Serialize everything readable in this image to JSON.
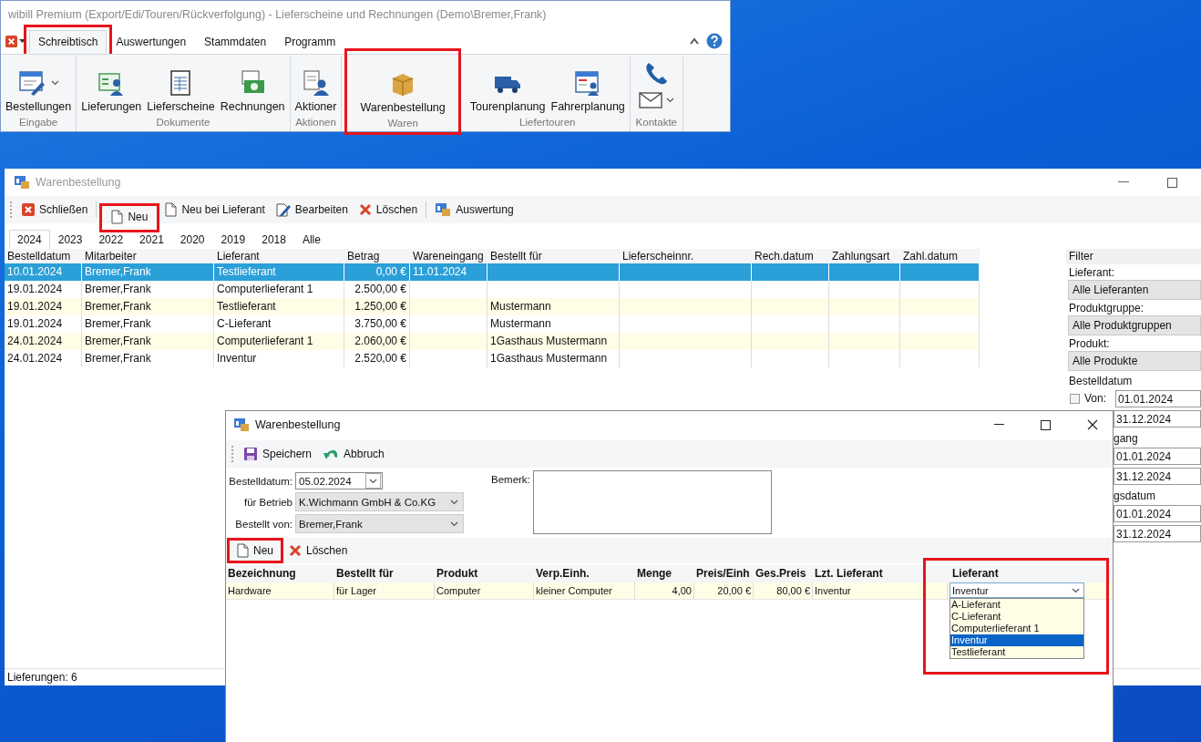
{
  "app_window": {
    "title": "wibill Premium (Export/Edi/Touren/Rückverfolgung) - Lieferscheine und Rechnungen (Demo\\Bremer,Frank)",
    "menu_tabs": [
      {
        "label": "Schreibtisch",
        "selected": true,
        "highlighted": true
      },
      {
        "label": "Auswertungen",
        "selected": false,
        "highlighted": false
      },
      {
        "label": "Stammdaten",
        "selected": false,
        "highlighted": false
      },
      {
        "label": "Programm",
        "selected": false,
        "highlighted": false
      }
    ],
    "ribbon_groups": [
      {
        "label": "Eingabe",
        "highlighted": false,
        "buttons": [
          {
            "label": "Bestellungen",
            "dropdown": true
          }
        ]
      },
      {
        "label": "Dokumente",
        "highlighted": false,
        "buttons": [
          {
            "label": "Lieferungen",
            "dropdown": false
          },
          {
            "label": "Lieferscheine",
            "dropdown": false
          },
          {
            "label": "Rechnungen",
            "dropdown": false
          }
        ]
      },
      {
        "label": "Aktionen",
        "highlighted": false,
        "buttons": [
          {
            "label": "Aktioner",
            "dropdown": false
          }
        ]
      },
      {
        "label": "Waren",
        "highlighted": true,
        "buttons": [
          {
            "label": "Warenbestellung",
            "dropdown": false
          }
        ]
      },
      {
        "label": "Liefertouren",
        "highlighted": false,
        "buttons": [
          {
            "label": "Tourenplanung",
            "dropdown": false
          },
          {
            "label": "Fahrerplanung",
            "dropdown": false
          }
        ]
      },
      {
        "label": "Kontakte",
        "highlighted": false,
        "buttons": [
          {
            "dropdown": false
          },
          {
            "dropdown": true
          }
        ]
      }
    ]
  },
  "order_window": {
    "title": "Warenbestellung",
    "toolbar": [
      {
        "label": "Schließen",
        "highlighted": false
      },
      {
        "label": "Neu",
        "highlighted": true
      },
      {
        "label": "Neu bei Lieferant",
        "highlighted": false
      },
      {
        "label": "Bearbeiten",
        "highlighted": false
      },
      {
        "label": "Löschen",
        "highlighted": false
      },
      {
        "label": "Auswertung",
        "highlighted": false
      }
    ],
    "year_tabs": [
      {
        "label": "2024",
        "selected": true
      },
      {
        "label": "2023",
        "selected": false
      },
      {
        "label": "2022",
        "selected": false
      },
      {
        "label": "2021",
        "selected": false
      },
      {
        "label": "2020",
        "selected": false
      },
      {
        "label": "2019",
        "selected": false
      },
      {
        "label": "2018",
        "selected": false
      },
      {
        "label": "Alle",
        "selected": false
      }
    ],
    "table": {
      "columns": [
        "Bestelldatum",
        "Mitarbeiter",
        "Lieferant",
        "Betrag",
        "Wareneingang",
        "Bestellt für",
        "Lieferscheinnr.",
        "Rech.datum",
        "Zahlungsart",
        "Zahl.datum"
      ],
      "rows": [
        {
          "selected": true,
          "bestelldatum": "10.01.2024",
          "mitarbeiter": "Bremer,Frank",
          "lieferant": "Testlieferant",
          "betrag": "0,00 €",
          "wareneingang": "11.01.2024"
        },
        {
          "selected": false,
          "bestelldatum": "19.01.2024",
          "mitarbeiter": "Bremer,Frank",
          "lieferant": "Computerlieferant 1",
          "betrag": "2.500,00 €"
        },
        {
          "selected": false,
          "bestelldatum": "19.01.2024",
          "mitarbeiter": "Bremer,Frank",
          "lieferant": "Testlieferant",
          "betrag": "1.250,00 €",
          "bestellt_fuer": "Mustermann"
        },
        {
          "selected": false,
          "bestelldatum": "19.01.2024",
          "mitarbeiter": "Bremer,Frank",
          "lieferant": "C-Lieferant",
          "betrag": "3.750,00 €",
          "bestellt_fuer": "Mustermann"
        },
        {
          "selected": false,
          "bestelldatum": "24.01.2024",
          "mitarbeiter": "Bremer,Frank",
          "lieferant": "Computerlieferant 1",
          "betrag": "2.060,00 €",
          "bestellt_fuer": "1Gasthaus Mustermann"
        },
        {
          "selected": false,
          "bestelldatum": "24.01.2024",
          "mitarbeiter": "Bremer,Frank",
          "lieferant": "Inventur",
          "betrag": "2.520,00 €",
          "bestellt_fuer": "1Gasthaus Mustermann"
        }
      ]
    },
    "filter": {
      "title": "Filter",
      "selects": [
        {
          "label": "Lieferant:",
          "value": "Alle Lieferanten"
        },
        {
          "label": "Produktgruppe:",
          "value": "Alle Produktgruppen"
        },
        {
          "label": "Produkt:",
          "value": "Alle Produkte"
        }
      ],
      "date_ranges": [
        {
          "label": "Bestelldatum",
          "from_label": "Von:",
          "from_checked": false,
          "from": "01.01.2024",
          "to": "31.12.2024"
        },
        {
          "label": "gang",
          "from": "01.01.2024",
          "to": "31.12.2024"
        },
        {
          "label": "gsdatum",
          "from": "01.01.2024",
          "to": "31.12.2024"
        }
      ]
    },
    "status_bar": "Lieferungen: 6"
  },
  "dialog": {
    "title": "Warenbestellung",
    "toolbar": [
      {
        "label": "Speichern"
      },
      {
        "label": "Abbruch"
      }
    ],
    "bestelldatum": {
      "label": "Bestelldatum:",
      "value": "05.02.2024"
    },
    "betrieb": {
      "label": "für Betrieb",
      "value": "K.Wichmann GmbH & Co.KG"
    },
    "bestellt_von": {
      "label": "Bestellt von:",
      "value": "Bremer,Frank"
    },
    "bemerk": {
      "label": "Bemerk:"
    },
    "position_toolbar": [
      {
        "label": "Neu",
        "highlighted": true
      },
      {
        "label": "Löschen",
        "highlighted": false
      }
    ],
    "positions": {
      "columns": [
        {
          "label": "Bezeichnung",
          "highlighted": false
        },
        {
          "label": "Bestellt für",
          "highlighted": false
        },
        {
          "label": "Produkt",
          "highlighted": false
        },
        {
          "label": "Verp.Einh.",
          "highlighted": false
        },
        {
          "label": "Menge",
          "highlighted": false
        },
        {
          "label": "Preis/Einh",
          "highlighted": false
        },
        {
          "label": "Ges.Preis",
          "highlighted": false
        },
        {
          "label": "Lzt. Lieferant",
          "highlighted": false
        },
        {
          "label": "Lieferant",
          "highlighted": true
        }
      ],
      "rows": [
        {
          "bezeichnung": "Hardware",
          "bestellt_fuer": "für Lager",
          "produkt": "Computer",
          "verp_einh": "kleiner Computer",
          "menge": "4,00",
          "preis": "20,00 €",
          "ges_preis": "80,00 €",
          "lzt_lieferant": "Inventur",
          "lieferant": {
            "value": "Inventur",
            "expanded": true,
            "options": [
              {
                "label": "A-Lieferant",
                "selected": false
              },
              {
                "label": "C-Lieferant",
                "selected": false
              },
              {
                "label": "Computerlieferant 1",
                "selected": false
              },
              {
                "label": "Inventur",
                "selected": true
              },
              {
                "label": "Testlieferant",
                "selected": false
              }
            ]
          }
        }
      ]
    }
  }
}
